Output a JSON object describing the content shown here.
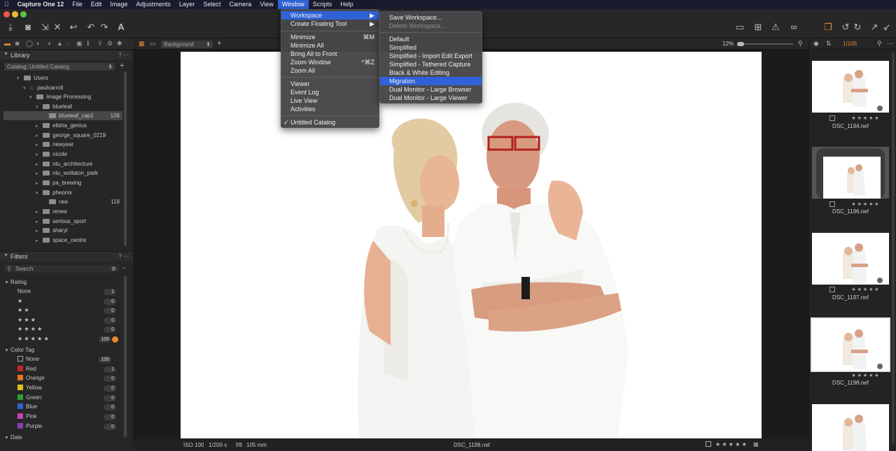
{
  "menubar": {
    "apple": "",
    "items": [
      "Capture One 12",
      "File",
      "Edit",
      "Image",
      "Adjustments",
      "Layer",
      "Select",
      "Camera",
      "View",
      "Window",
      "Scripts",
      "Help"
    ],
    "active": "Window"
  },
  "window_menu": {
    "items": [
      {
        "label": "Workspace",
        "arrow": "▶"
      },
      {
        "label": "Create Floating Tool",
        "arrow": "▶"
      },
      {
        "label": "Minimize",
        "shortcut": "⌘M"
      },
      {
        "label": "Minimize All"
      },
      {
        "label": "Bring All to Front"
      },
      {
        "label": "Zoom Window",
        "shortcut": "^⌘Z"
      },
      {
        "label": "Zoom All"
      },
      {
        "label": "Viewer"
      },
      {
        "label": "Event Log"
      },
      {
        "label": "Live View"
      },
      {
        "label": "Activities"
      },
      {
        "label": "Untitled Catalog",
        "check": "✓"
      }
    ]
  },
  "workspace_menu": {
    "items": [
      {
        "label": "Save Workspace..."
      },
      {
        "label": "Delete Workspace..."
      },
      {
        "label": "Default"
      },
      {
        "label": "Simplified"
      },
      {
        "label": "Simplified - Import Edit Export"
      },
      {
        "label": "Simplified - Tethered Capture"
      },
      {
        "label": "Black & White Editing"
      },
      {
        "label": "Migration"
      },
      {
        "label": "Dual Monitor - Large Browser"
      },
      {
        "label": "Dual Monitor - Large Viewer"
      }
    ]
  },
  "library": {
    "title": "Library",
    "catalog_select": "Catalog: Untitled Catalog",
    "tree": [
      {
        "label": "Users"
      },
      {
        "label": "paulcarroll"
      },
      {
        "label": "Image Processing"
      },
      {
        "label": "blueleaf"
      },
      {
        "label": "blueleaf_cap1",
        "count": "106"
      },
      {
        "label": "elisha_genius"
      },
      {
        "label": "george_square_0219"
      },
      {
        "label": "newyear"
      },
      {
        "label": "nicole"
      },
      {
        "label": "ntu_architecture"
      },
      {
        "label": "ntu_wollaton_park"
      },
      {
        "label": "pa_brewing"
      },
      {
        "label": "pheonix"
      },
      {
        "label": "raw",
        "count": "118"
      },
      {
        "label": "renea"
      },
      {
        "label": "serious_sport"
      },
      {
        "label": "sharyl"
      },
      {
        "label": "space_centre"
      }
    ]
  },
  "filters": {
    "title": "Filters",
    "search_placeholder": "Search",
    "rating_title": "Rating",
    "ratings": [
      {
        "label": "None",
        "count": "1"
      },
      {
        "label": "★",
        "count": "0"
      },
      {
        "label": "★ ★",
        "count": "0"
      },
      {
        "label": "★ ★ ★",
        "count": "0"
      },
      {
        "label": "★ ★ ★ ★",
        "count": "0"
      },
      {
        "label": "★ ★ ★ ★ ★",
        "count": "105"
      }
    ],
    "color_title": "Color Tag",
    "colors": [
      {
        "label": "None",
        "count": "105",
        "color": "#262626"
      },
      {
        "label": "Red",
        "count": "1",
        "color": "#c1272d"
      },
      {
        "label": "Orange",
        "count": "0",
        "color": "#e0781f"
      },
      {
        "label": "Yellow",
        "count": "0",
        "color": "#d9c21e"
      },
      {
        "label": "Green",
        "count": "0",
        "color": "#2f9e34"
      },
      {
        "label": "Blue",
        "count": "0",
        "color": "#2d62d0"
      },
      {
        "label": "Pink",
        "count": "0",
        "color": "#c542b8"
      },
      {
        "label": "Purple",
        "count": "0",
        "color": "#8b3fb3"
      }
    ],
    "date_title": "Date",
    "accent": "#e8882a"
  },
  "viewer": {
    "style_select": "Background",
    "zoom": "12%",
    "status_iso": "ISO 100",
    "status_shutter": "1/200 s",
    "status_aperture": "f/8",
    "status_focal": "105 mm",
    "status_filename": "DSC_1198.nef"
  },
  "browser": {
    "counter": "1/105",
    "thumbs": [
      {
        "name": "DSC_1194.nef"
      },
      {
        "name": "DSC_1196.nef"
      },
      {
        "name": "DSC_1197.nef"
      },
      {
        "name": "DSC_1198.nef"
      },
      {
        "name": ""
      }
    ],
    "stars": "★ ★ ★ ★ ★"
  }
}
